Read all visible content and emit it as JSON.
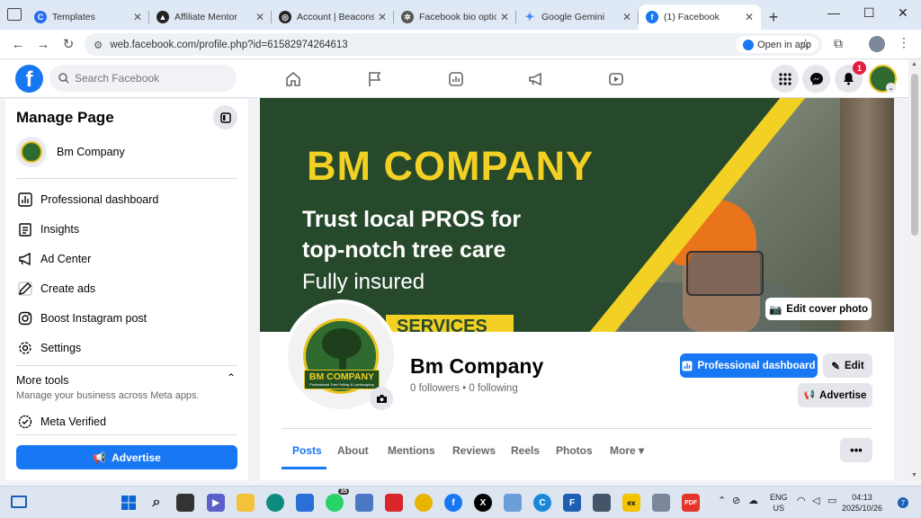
{
  "browser": {
    "tabs": [
      {
        "title": "Templates",
        "favicon_color": "#2a6df4"
      },
      {
        "title": "Affiliate Mentor",
        "favicon_color": "#222222"
      },
      {
        "title": "Account | Beacons",
        "favicon_color": "#222222"
      },
      {
        "title": "Facebook bio option",
        "favicon_color": "#555555"
      },
      {
        "title": "Google Gemini",
        "favicon_color": "#4a8af4"
      },
      {
        "title": "(1) Facebook",
        "favicon_color": "#1877f2"
      }
    ],
    "url": "web.facebook.com/profile.php?id=61582974264613",
    "open_in_app": "Open in app"
  },
  "fb_header": {
    "logo": "f",
    "search_placeholder": "Search Facebook",
    "notification_count": "1"
  },
  "sidebar": {
    "title": "Manage Page",
    "page_name": "Bm Company",
    "items": [
      {
        "label": "Professional dashboard",
        "icon": "dashboard-icon"
      },
      {
        "label": "Insights",
        "icon": "insights-icon"
      },
      {
        "label": "Ad Center",
        "icon": "megaphone-icon"
      },
      {
        "label": "Create ads",
        "icon": "pencil-icon"
      },
      {
        "label": "Boost Instagram post",
        "icon": "instagram-icon"
      },
      {
        "label": "Settings",
        "icon": "gear-icon"
      }
    ],
    "more_tools": "More tools",
    "more_tools_sub": "Manage your business across Meta apps.",
    "meta_verified": "Meta Verified",
    "advertise": "Advertise"
  },
  "cover": {
    "title": "BM COMPANY",
    "line1": "Trust local PROS for",
    "line2": "top-notch tree care",
    "line3": "Fully insured",
    "ribbon": "SERVICES",
    "edit_cover": "Edit cover photo"
  },
  "profile": {
    "logo_text": "BM COMPANY",
    "logo_small": "Professional Tree Felling & Landscaping",
    "name": "Bm Company",
    "followers": "0 followers • 0 following",
    "btn_dashboard": "Professional dashboard",
    "btn_edit": "Edit",
    "btn_advertise": "Advertise",
    "tabs": [
      "Posts",
      "About",
      "Mentions",
      "Reviews",
      "Reels",
      "Photos",
      "More ▾"
    ],
    "more_dots": "•••"
  },
  "taskbar": {
    "chrome_badge": "35",
    "lang": "ENG",
    "region": "US",
    "time": "04:13",
    "date": "2025/10/26",
    "notif": "7"
  },
  "colors": {
    "fb_blue": "#1877f2",
    "cover_green": "#27492b",
    "cover_yellow": "#f2d024"
  }
}
